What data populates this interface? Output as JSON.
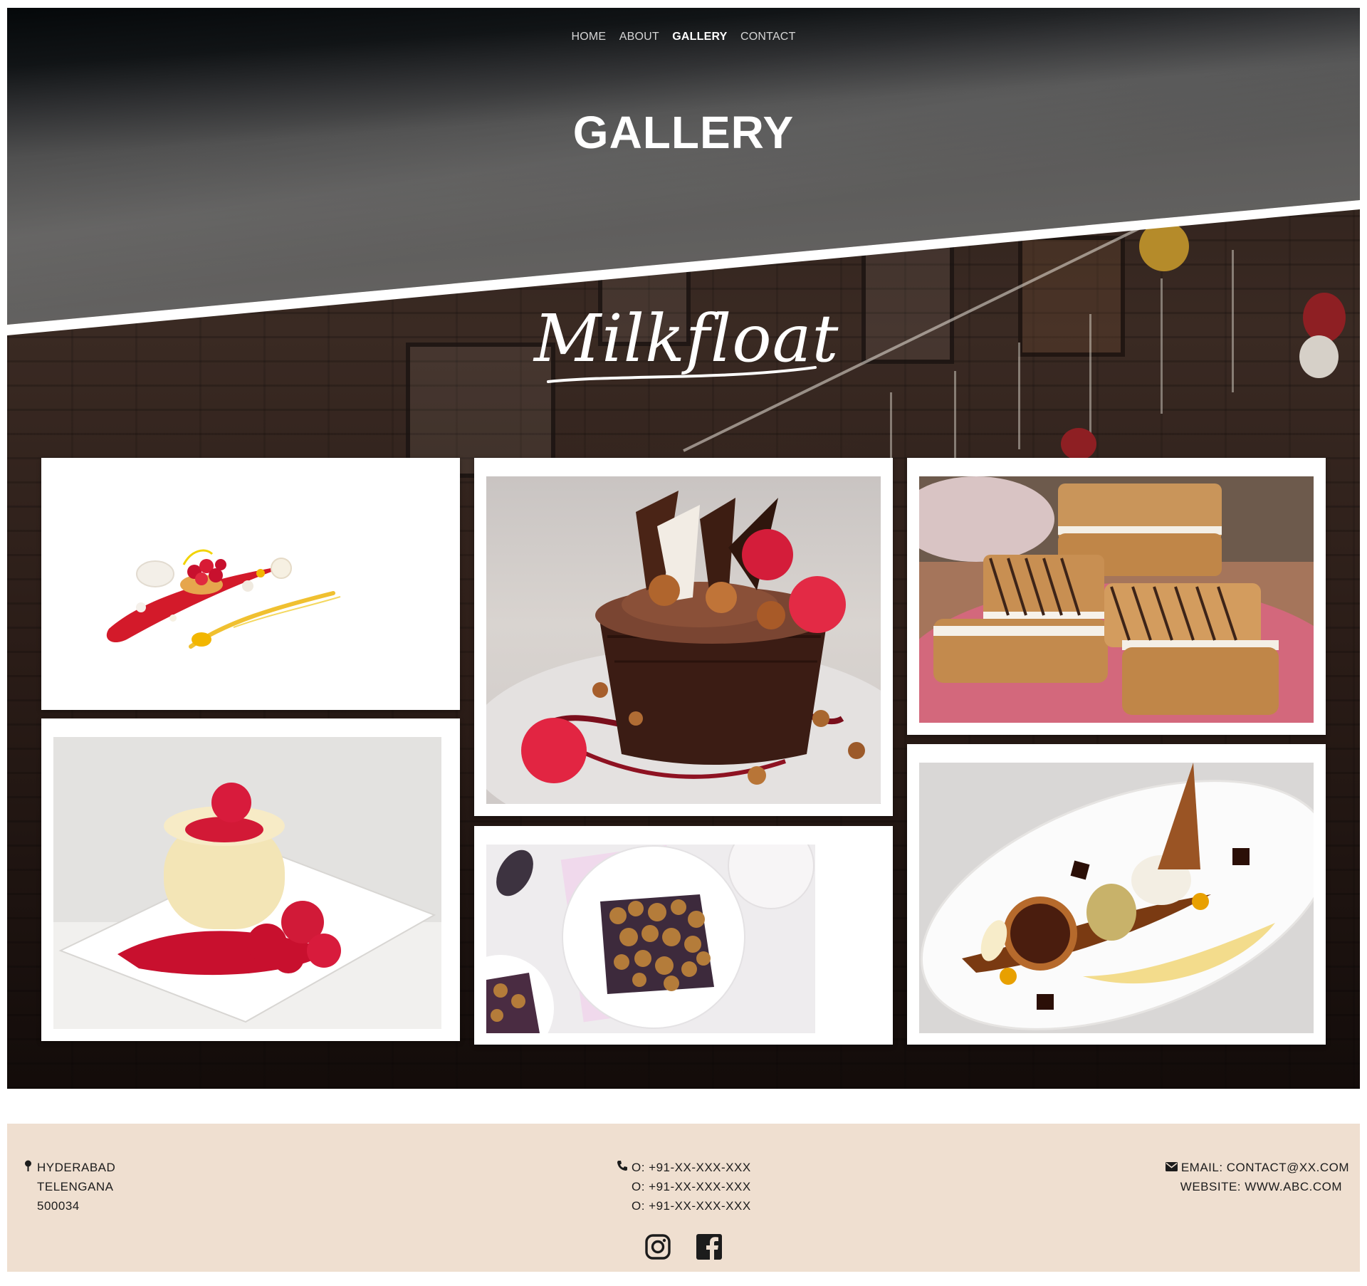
{
  "nav": {
    "items": [
      {
        "label": "HOME",
        "active": false
      },
      {
        "label": "ABOUT",
        "active": false
      },
      {
        "label": "GALLERY",
        "active": true
      },
      {
        "label": "CONTACT",
        "active": false
      }
    ]
  },
  "hero": {
    "title": "GALLERY",
    "logo_text": "Milkfloat"
  },
  "gallery": {
    "photos": [
      {
        "name": "raspberry-tart-plate"
      },
      {
        "name": "chocolate-cup-dessert"
      },
      {
        "name": "grilled-sponge-cake"
      },
      {
        "name": "vanilla-mousse-raspberry"
      },
      {
        "name": "berry-crumble"
      },
      {
        "name": "chocolate-tart-plate"
      }
    ]
  },
  "footer": {
    "address": {
      "icon": "map-pin-icon",
      "line1": "HYDERABAD",
      "line2": "TELENGANA",
      "line3": "500034"
    },
    "phones": {
      "icon": "phone-icon",
      "line1": "O: +91-XX-XXX-XXX",
      "line2": "O: +91-XX-XXX-XXX",
      "line3": "O: +91-XX-XXX-XXX"
    },
    "contact": {
      "icon": "envelope-icon",
      "email": "EMAIL: CONTACT@XX.COM",
      "website": "WEBSITE: WWW.ABC.COM"
    },
    "social": [
      {
        "icon": "instagram-icon"
      },
      {
        "icon": "facebook-icon"
      }
    ]
  },
  "colors": {
    "footer_bg": "#efdfd0",
    "text_dark": "#1c1c1c",
    "white": "#ffffff"
  }
}
